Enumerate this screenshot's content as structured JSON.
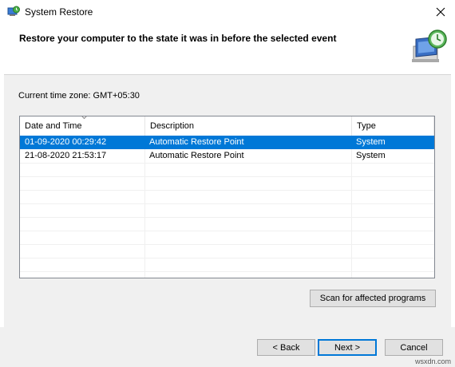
{
  "window": {
    "title": "System Restore"
  },
  "header": {
    "text": "Restore your computer to the state it was in before the selected event"
  },
  "timezone": {
    "label": "Current time zone: GMT+05:30"
  },
  "table": {
    "columns": [
      "Date and Time",
      "Description",
      "Type"
    ],
    "rows": [
      {
        "date": "01-09-2020 00:29:42",
        "description": "Automatic Restore Point",
        "type": "System",
        "selected": true
      },
      {
        "date": "21-08-2020 21:53:17",
        "description": "Automatic Restore Point",
        "type": "System",
        "selected": false
      }
    ]
  },
  "buttons": {
    "scan": "Scan for affected programs",
    "back": "< Back",
    "next": "Next >",
    "cancel": "Cancel"
  },
  "watermark": "wsxdn.com",
  "colors": {
    "selection": "#0078d7",
    "dialog_bg": "#f0f0f0"
  }
}
